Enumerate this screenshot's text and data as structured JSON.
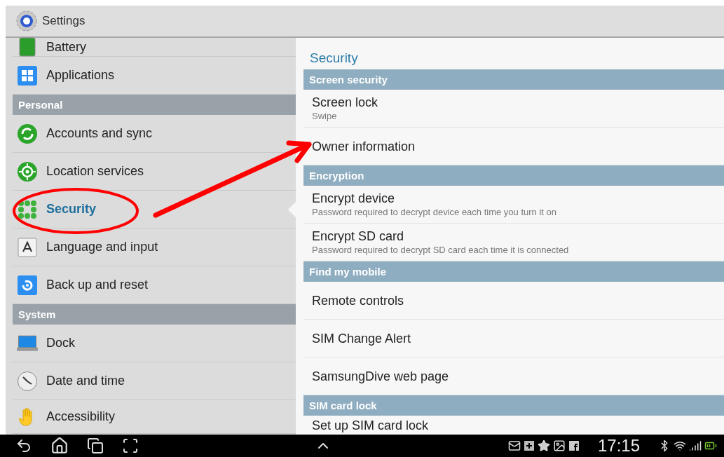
{
  "title_bar": {
    "title": "Settings"
  },
  "sidebar": {
    "items": [
      {
        "kind": "item",
        "label": "Battery",
        "selected": false
      },
      {
        "kind": "item",
        "label": "Applications",
        "selected": false
      },
      {
        "kind": "header",
        "label": "Personal"
      },
      {
        "kind": "item",
        "label": "Accounts and sync",
        "selected": false
      },
      {
        "kind": "item",
        "label": "Location services",
        "selected": false
      },
      {
        "kind": "item",
        "label": "Security",
        "selected": true
      },
      {
        "kind": "item",
        "label": "Language and input",
        "selected": false
      },
      {
        "kind": "item",
        "label": "Back up and reset",
        "selected": false
      },
      {
        "kind": "header",
        "label": "System"
      },
      {
        "kind": "item",
        "label": "Dock",
        "selected": false
      },
      {
        "kind": "item",
        "label": "Date and time",
        "selected": false
      },
      {
        "kind": "item",
        "label": "Accessibility",
        "selected": false
      }
    ]
  },
  "detail": {
    "title": "Security",
    "sections": [
      {
        "header": "Screen security",
        "items": [
          {
            "title": "Screen lock",
            "summary": "Swipe"
          },
          {
            "title": "Owner information"
          }
        ]
      },
      {
        "header": "Encryption",
        "items": [
          {
            "title": "Encrypt device",
            "summary": "Password required to decrypt device each time you turn it on"
          },
          {
            "title": "Encrypt SD card",
            "summary": "Password required to decrypt SD card each time it is connected"
          }
        ]
      },
      {
        "header": "Find my mobile",
        "items": [
          {
            "title": "Remote controls"
          },
          {
            "title": "SIM Change Alert"
          },
          {
            "title": "SamsungDive web page"
          }
        ]
      },
      {
        "header": "SIM card lock",
        "items": [
          {
            "title": "Set up SIM card lock"
          }
        ]
      }
    ]
  },
  "status_bar": {
    "time": "17:15"
  }
}
